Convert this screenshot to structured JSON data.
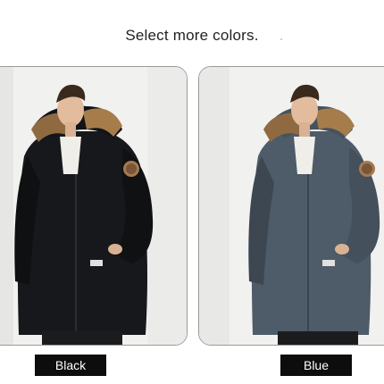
{
  "header": {
    "title": "Select more colors."
  },
  "colors": {
    "black": {
      "label": "Black",
      "jacket": "#16181b",
      "jacket_shade": "#0b0c0e"
    },
    "blue": {
      "label": "Blue",
      "jacket": "#4e5b68",
      "jacket_shade": "#3c4752"
    },
    "fur": "#9a7548",
    "skin": "#e2bc9d",
    "hair": "#3a2a1e",
    "sweater": "#efeee9",
    "background": "#f2f2f0",
    "label_bg": "#0d0d0d"
  },
  "products": [
    {
      "name_key": "black"
    },
    {
      "name_key": "blue"
    }
  ]
}
